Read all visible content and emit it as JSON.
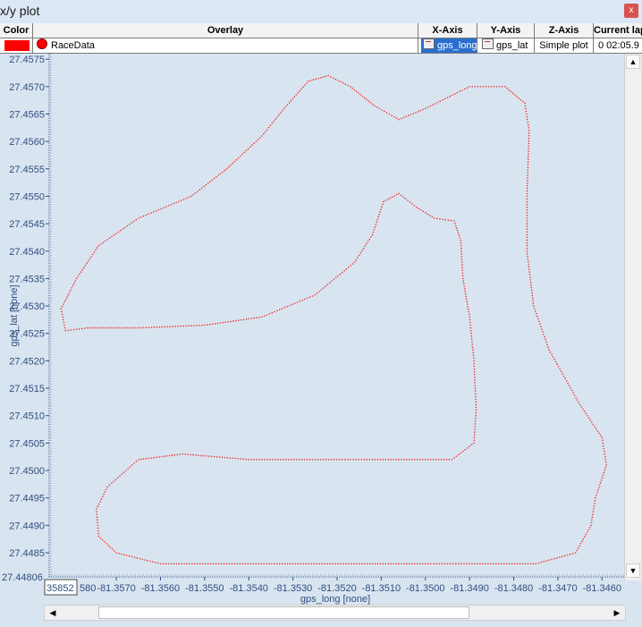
{
  "window": {
    "title": "x/y plot",
    "close_label": "x"
  },
  "grid": {
    "headers": {
      "color": "Color",
      "overlay": "Overlay",
      "x_axis": "X-Axis",
      "y_axis": "Y-Axis",
      "z_axis": "Z-Axis",
      "current_lap": "Current lap"
    },
    "row": {
      "color": "#ff0000",
      "overlay": "RaceData",
      "x_axis": "gps_long",
      "y_axis": "gps_lat",
      "z_axis": "Simple plot",
      "current_lap": "0  02:05.9"
    }
  },
  "chart_data": {
    "type": "scatter",
    "xlabel": "gps_long [none]",
    "ylabel": "gps_lat [none]",
    "xlim": [
      -81.35852,
      -81.3455
    ],
    "ylim": [
      27.44806,
      27.4576
    ],
    "x_ticks": [
      "-81.3570",
      "-81.3560",
      "-81.3550",
      "-81.3540",
      "-81.3530",
      "-81.3520",
      "-81.3510",
      "-81.3500",
      "-81.3490",
      "-81.3480",
      "-81.3470",
      "-81.3460"
    ],
    "x_tick_values": [
      -81.357,
      -81.356,
      -81.355,
      -81.354,
      -81.353,
      -81.352,
      -81.351,
      -81.35,
      -81.349,
      -81.348,
      -81.347,
      -81.346
    ],
    "x_edge_label": "35852",
    "x_edge_partial": "580",
    "y_ticks": [
      "27.4575",
      "27.4570",
      "27.4565",
      "27.4560",
      "27.4555",
      "27.4550",
      "27.4545",
      "27.4540",
      "27.4535",
      "27.4530",
      "27.4525",
      "27.4520",
      "27.4515",
      "27.4510",
      "27.4505",
      "27.4500",
      "27.4495",
      "27.4490",
      "27.4485"
    ],
    "y_tick_values": [
      27.4575,
      27.457,
      27.4565,
      27.456,
      27.4555,
      27.455,
      27.4545,
      27.454,
      27.4535,
      27.453,
      27.4525,
      27.452,
      27.4515,
      27.451,
      27.4505,
      27.45,
      27.4495,
      27.449,
      27.4485
    ],
    "y_edge_label": "27.44806",
    "series_color": "#e8312b",
    "track": [
      [
        -81.35825,
        27.45295
      ],
      [
        -81.35815,
        27.45255
      ],
      [
        -81.35765,
        27.4526
      ],
      [
        -81.3565,
        27.4526
      ],
      [
        -81.355,
        27.45265
      ],
      [
        -81.3537,
        27.4528
      ],
      [
        -81.3525,
        27.4532
      ],
      [
        -81.3516,
        27.4538
      ],
      [
        -81.3512,
        27.4543
      ],
      [
        -81.35095,
        27.4549
      ],
      [
        -81.3506,
        27.45505
      ],
      [
        -81.3502,
        27.4548
      ],
      [
        -81.3498,
        27.4546
      ],
      [
        -81.34935,
        27.45455
      ],
      [
        -81.3492,
        27.4542
      ],
      [
        -81.34915,
        27.4535
      ],
      [
        -81.349,
        27.4528
      ],
      [
        -81.3489,
        27.452
      ],
      [
        -81.34885,
        27.4511
      ],
      [
        -81.3489,
        27.4505
      ],
      [
        -81.3494,
        27.4502
      ],
      [
        -81.35,
        27.4502
      ],
      [
        -81.3512,
        27.4502
      ],
      [
        -81.3525,
        27.4502
      ],
      [
        -81.354,
        27.4502
      ],
      [
        -81.3555,
        27.4503
      ],
      [
        -81.3565,
        27.4502
      ],
      [
        -81.3572,
        27.4497
      ],
      [
        -81.35745,
        27.4493
      ],
      [
        -81.3574,
        27.4488
      ],
      [
        -81.357,
        27.4485
      ],
      [
        -81.356,
        27.4483
      ],
      [
        -81.3545,
        27.4483
      ],
      [
        -81.353,
        27.4483
      ],
      [
        -81.3515,
        27.4483
      ],
      [
        -81.35,
        27.4483
      ],
      [
        -81.349,
        27.4483
      ],
      [
        -81.3475,
        27.4483
      ],
      [
        -81.3466,
        27.4485
      ],
      [
        -81.34625,
        27.449
      ],
      [
        -81.34615,
        27.4495
      ],
      [
        -81.3459,
        27.4501
      ],
      [
        -81.346,
        27.4506
      ],
      [
        -81.3465,
        27.4512
      ],
      [
        -81.3472,
        27.4522
      ],
      [
        -81.34755,
        27.453
      ],
      [
        -81.3477,
        27.454
      ],
      [
        -81.3477,
        27.455
      ],
      [
        -81.34765,
        27.4562
      ],
      [
        -81.34775,
        27.4567
      ],
      [
        -81.3482,
        27.457
      ],
      [
        -81.349,
        27.457
      ],
      [
        -81.35,
        27.4566
      ],
      [
        -81.3506,
        27.4564
      ],
      [
        -81.35115,
        27.45665
      ],
      [
        -81.3517,
        27.457
      ],
      [
        -81.3522,
        27.4572
      ],
      [
        -81.35265,
        27.4571
      ],
      [
        -81.3532,
        27.4566
      ],
      [
        -81.3537,
        27.4561
      ],
      [
        -81.3545,
        27.4555
      ],
      [
        -81.3553,
        27.455
      ],
      [
        -81.3565,
        27.4546
      ],
      [
        -81.3574,
        27.4541
      ],
      [
        -81.3579,
        27.4535
      ],
      [
        -81.35825,
        27.45295
      ]
    ]
  }
}
